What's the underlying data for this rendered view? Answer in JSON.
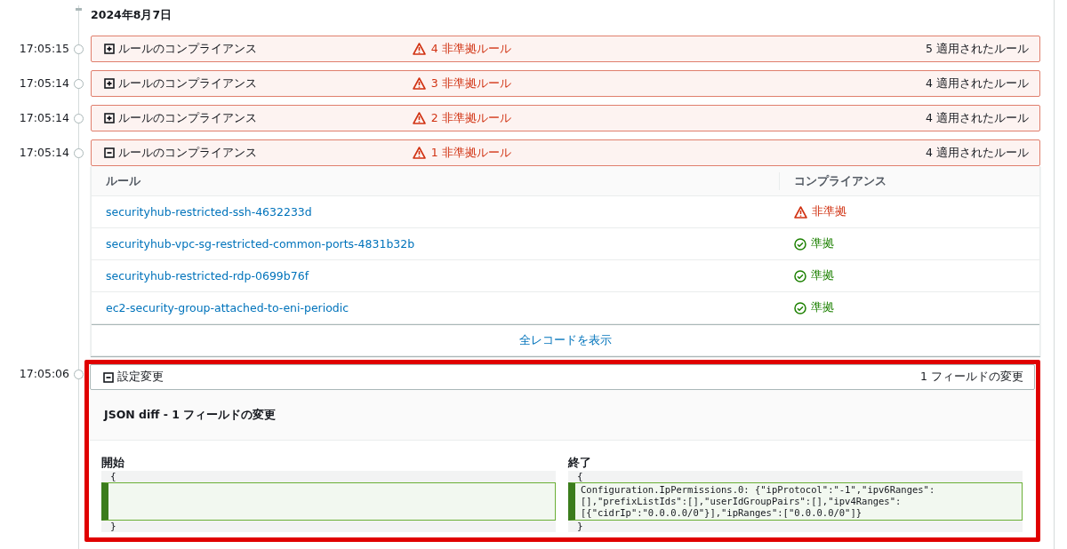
{
  "date": "2024年8月7日",
  "events": [
    {
      "kind": "compliance",
      "time": "17:05:15",
      "expanded": false,
      "title": "ルールのコンプライアンス",
      "noncompliant": "4 非準拠ルール",
      "applied": "5 適用されたルール"
    },
    {
      "kind": "compliance",
      "time": "17:05:14",
      "expanded": false,
      "title": "ルールのコンプライアンス",
      "noncompliant": "3 非準拠ルール",
      "applied": "4 適用されたルール"
    },
    {
      "kind": "compliance",
      "time": "17:05:14",
      "expanded": false,
      "title": "ルールのコンプライアンス",
      "noncompliant": "2 非準拠ルール",
      "applied": "4 適用されたルール"
    },
    {
      "kind": "compliance",
      "time": "17:05:14",
      "expanded": true,
      "title": "ルールのコンプライアンス",
      "noncompliant": "1 非準拠ルール",
      "applied": "4 適用されたルール",
      "table": {
        "columns": [
          "ルール",
          "コンプライアンス"
        ],
        "rows": [
          {
            "rule": "securityhub-restricted-ssh-4632233d",
            "kind": "noncompliant",
            "label": "非準拠"
          },
          {
            "rule": "securityhub-vpc-sg-restricted-common-ports-4831b32b",
            "kind": "compliant",
            "label": "準拠"
          },
          {
            "rule": "securityhub-restricted-rdp-0699b76f",
            "kind": "compliant",
            "label": "準拠"
          },
          {
            "rule": "ec2-security-group-attached-to-eni-periodic",
            "kind": "compliant",
            "label": "準拠"
          }
        ],
        "footer_link": "全レコードを表示"
      }
    },
    {
      "kind": "config",
      "time": "17:05:06",
      "expanded": true,
      "highlighted": true,
      "title": "設定変更",
      "summary": "1 フィールドの変更",
      "diff": {
        "title": "JSON diff - 1 フィールドの変更",
        "before": {
          "label": "開始",
          "open": "{",
          "close": "}"
        },
        "after": {
          "label": "終了",
          "open": "{",
          "added": "Configuration.IpPermissions.0: {\"ipProtocol\":\"-1\",\"ipv6Ranges\":\n[],\"prefixListIds\":[],\"userIdGroupPairs\":[],\"ipv4Ranges\":\n[{\"cidrIp\":\"0.0.0.0/0\"}],\"ipRanges\":[\"0.0.0.0/0\"]}",
          "close": "}"
        }
      }
    }
  ]
}
